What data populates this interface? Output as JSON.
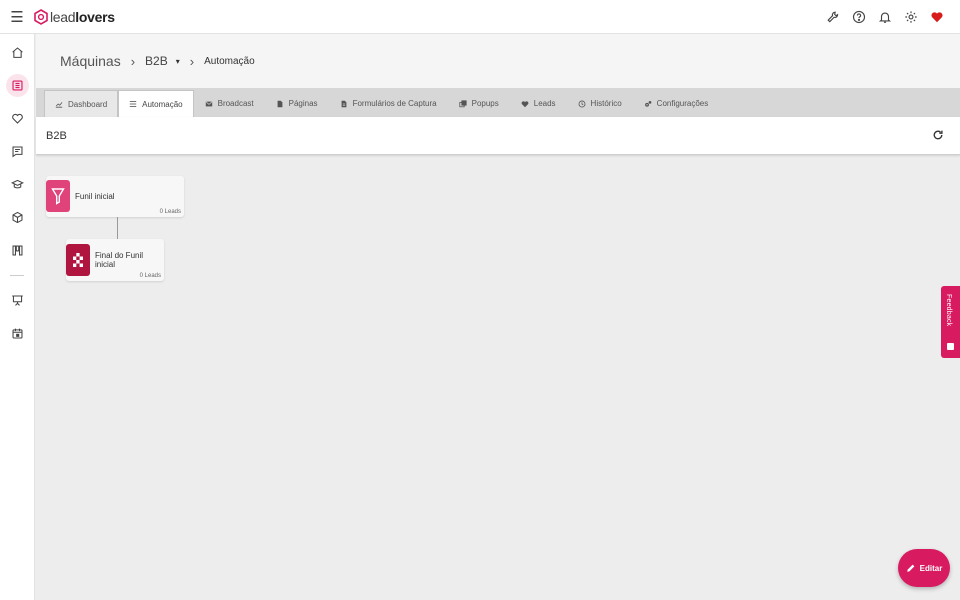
{
  "app": {
    "logo_lead": "lead",
    "logo_lovers": "lovers",
    "brand_color": "#d81b60"
  },
  "topbar": {
    "icons": [
      "wrench-icon",
      "help-icon",
      "bell-icon",
      "gear-icon",
      "heart-icon"
    ]
  },
  "sidebar": {
    "items": [
      "home-icon",
      "funnel-grid-icon",
      "heart-outline-icon",
      "chat-list-icon",
      "graduation-cap-icon",
      "box-icon",
      "kanban-icon",
      "presentation-icon",
      "calendar-icon"
    ],
    "active_index": 1
  },
  "breadcrumb": {
    "root": "Máquinas",
    "machine": "B2B",
    "current": "Automação",
    "separator": "›",
    "caret": "▾"
  },
  "tabs": [
    {
      "label": "Dashboard",
      "icon": "chart-line-icon"
    },
    {
      "label": "Automação",
      "icon": "list-icon"
    },
    {
      "label": "Broadcast",
      "icon": "envelope-icon"
    },
    {
      "label": "Páginas",
      "icon": "file-icon"
    },
    {
      "label": "Formulários de Captura",
      "icon": "form-icon"
    },
    {
      "label": "Popups",
      "icon": "popup-icon"
    },
    {
      "label": "Leads",
      "icon": "heart-icon"
    },
    {
      "label": "Histórico",
      "icon": "clock-icon"
    },
    {
      "label": "Configurações",
      "icon": "cogs-icon"
    }
  ],
  "active_tab": "Automação",
  "title": "B2B",
  "nodes": [
    {
      "title": "Funil inicial",
      "leads": "0 Leads",
      "color": "#e0437a",
      "icon": "funnel-icon"
    },
    {
      "title": "Final do Funil inicial",
      "leads": "0 Leads",
      "color": "#b0153f",
      "icon": "finish-flag-icon"
    }
  ],
  "feedback": {
    "label": "Feedback"
  },
  "fab": {
    "label": "Editar",
    "icon": "pencil-icon"
  }
}
